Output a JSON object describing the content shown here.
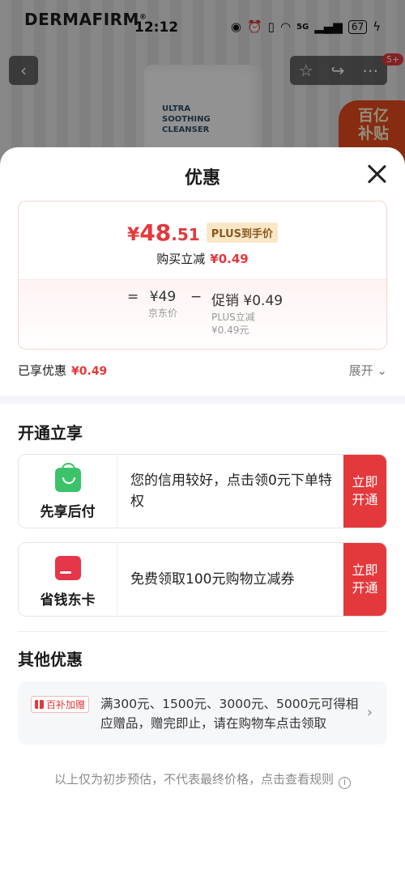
{
  "background": {
    "brand": "DERMAFIRM",
    "brand_mark": "®",
    "product_label": "ULTRA\nSOOTHING\nCLEANSER",
    "promo_badge": "百亿\n补贴",
    "nav_badge": "5+"
  },
  "status_bar": {
    "time": "12:12",
    "battery": "67",
    "network": "5G"
  },
  "sheet": {
    "title": "优惠",
    "price": {
      "yen": "¥",
      "integer": "48",
      "decimal": ".51",
      "plus_tag": "PLUS到手价",
      "reduce_label": "购买立减",
      "reduce_value": "¥0.49"
    },
    "calc": {
      "equals": "=",
      "base_value": "¥49",
      "base_label": "京东价",
      "minus": "−",
      "promo_value": "促销 ¥0.49",
      "promo_sub1": "PLUS立减",
      "promo_sub2": "¥0.49元"
    },
    "enjoyed_label": "已享优惠",
    "enjoyed_value": "¥0.49",
    "expand_label": "展开 ⌄"
  },
  "open_section": {
    "title": "开通立享",
    "offers": [
      {
        "name": "先享后付",
        "text": "您的信用较好，点击领0元下单特权",
        "button": "立即开通",
        "icon": "shopping-bag-icon",
        "color": "#3cc36a"
      },
      {
        "name": "省钱东卡",
        "text": "免费领取100元购物立减券",
        "button": "立即开通",
        "icon": "card-icon",
        "color": "#e6364a"
      }
    ]
  },
  "other_section": {
    "title": "其他优惠",
    "tag": "百补加赠",
    "text": "满300元、1500元、3000元、5000元可得相应赠品，赠完即止，请在购物车点击领取"
  },
  "footer_note": "以上仅为初步预估，不代表最终价格，点击查看规则",
  "colors": {
    "accent": "#e4393c",
    "plus_tag_bg": "#fbe7c8",
    "plus_tag_text": "#8a5a1e"
  }
}
